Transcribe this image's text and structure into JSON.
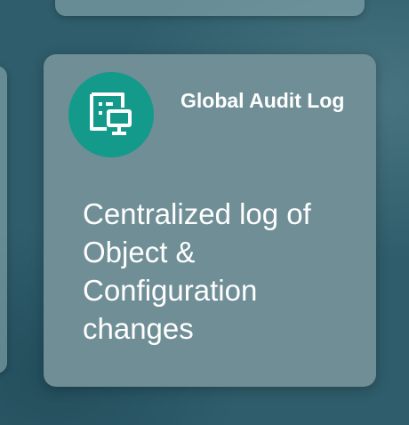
{
  "card": {
    "title": "Global Audit Log",
    "description": "Centralized log of Object & Configuration changes",
    "icon": "audit-log-monitor-icon"
  },
  "colors": {
    "background": "#2f5d6b",
    "card": "#6f8e96",
    "icon_circle": "#139a8a",
    "text": "#ffffff"
  }
}
